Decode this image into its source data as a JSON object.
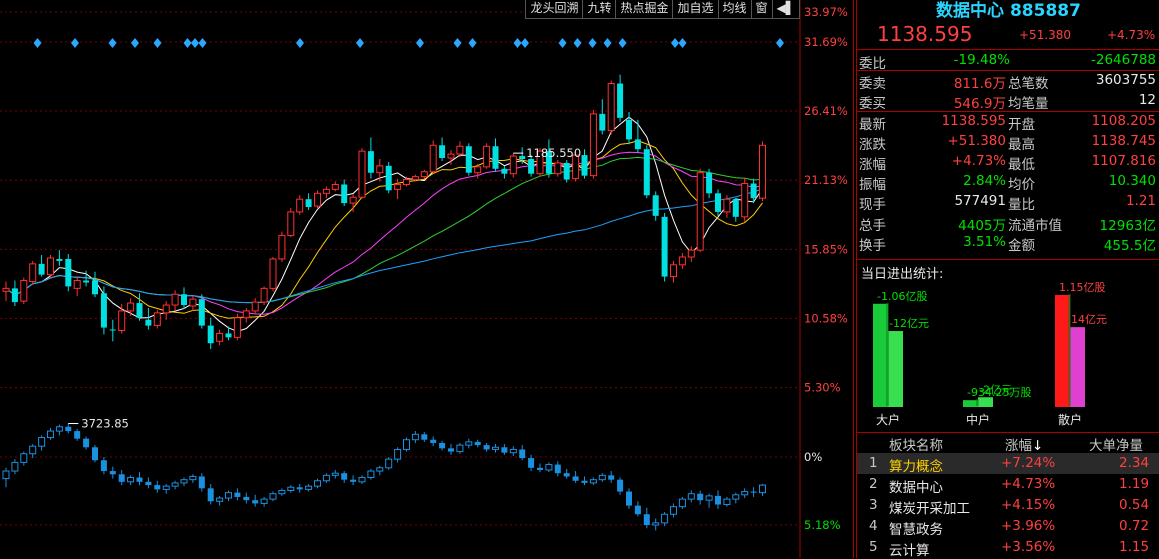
{
  "toolbar": {
    "items": [
      "龙头回溯",
      "九转",
      "热点掘金",
      "加自选",
      "均线",
      "窗"
    ]
  },
  "chart_data": {
    "type": "candlestick",
    "pct_axis": {
      "ticks": [
        {
          "label": "33.97%",
          "value": 33.97,
          "color": "#ff4040"
        },
        {
          "label": "31.69%",
          "value": 31.69,
          "color": "#ff4040"
        },
        {
          "label": "26.41%",
          "value": 26.41,
          "color": "#ff4040"
        },
        {
          "label": "21.13%",
          "value": 21.13,
          "color": "#ff4040"
        },
        {
          "label": "15.85%",
          "value": 15.85,
          "color": "#ff4040"
        },
        {
          "label": "10.58%",
          "value": 10.58,
          "color": "#ff4040"
        },
        {
          "label": "5.30%",
          "value": 5.3,
          "color": "#ff4040"
        },
        {
          "label": "0%",
          "value": 0,
          "color": "#e8e8e8"
        },
        {
          "label": "5.18%",
          "value": -5.18,
          "color": "#00e000"
        }
      ]
    },
    "annotations": [
      {
        "label": "1185.550",
        "series": "sector",
        "index": 57,
        "kind": "high"
      },
      {
        "label": "3723.85",
        "series": "index",
        "index": 7,
        "kind": "high"
      }
    ],
    "sector_series": {
      "name": "",
      "ohlc": [
        [
          21.5,
          22.5,
          20.5,
          21.8
        ],
        [
          21.8,
          22.6,
          20.0,
          20.4
        ],
        [
          20.5,
          22.9,
          20.2,
          22.6
        ],
        [
          22.5,
          24.6,
          22.2,
          24.3
        ],
        [
          24.3,
          25.2,
          23.0,
          23.2
        ],
        [
          23.2,
          25.2,
          22.8,
          24.9
        ],
        [
          24.8,
          25.7,
          24.1,
          24.6
        ],
        [
          24.8,
          25.3,
          21.5,
          22.0
        ],
        [
          21.8,
          23.0,
          21.0,
          22.6
        ],
        [
          22.6,
          23.6,
          22.0,
          22.4
        ],
        [
          22.6,
          23.5,
          20.9,
          21.2
        ],
        [
          21.3,
          22.0,
          17.1,
          17.8
        ],
        [
          17.6,
          18.6,
          16.4,
          17.5
        ],
        [
          17.5,
          20.2,
          17.2,
          19.5
        ],
        [
          19.5,
          20.8,
          19.0,
          20.3
        ],
        [
          20.3,
          21.3,
          18.5,
          18.8
        ],
        [
          18.6,
          19.8,
          17.6,
          18.0
        ],
        [
          18.0,
          19.6,
          17.7,
          19.3
        ],
        [
          19.3,
          20.5,
          18.6,
          20.1
        ],
        [
          20.1,
          21.6,
          19.5,
          21.2
        ],
        [
          21.2,
          21.9,
          19.7,
          20.1
        ],
        [
          20.0,
          21.0,
          19.5,
          20.7
        ],
        [
          20.7,
          21.2,
          17.7,
          18.0
        ],
        [
          18.0,
          18.8,
          15.6,
          16.2
        ],
        [
          16.4,
          17.6,
          16.0,
          17.2
        ],
        [
          17.2,
          17.9,
          16.5,
          16.8
        ],
        [
          16.8,
          19.2,
          16.5,
          18.8
        ],
        [
          18.8,
          19.8,
          18.3,
          19.5
        ],
        [
          19.5,
          20.8,
          19.2,
          20.4
        ],
        [
          20.4,
          22.0,
          20.1,
          21.8
        ],
        [
          21.8,
          25.0,
          21.5,
          24.8
        ],
        [
          24.8,
          27.6,
          24.5,
          27.2
        ],
        [
          27.2,
          30.0,
          27.0,
          29.6
        ],
        [
          29.6,
          31.3,
          29.3,
          30.9
        ],
        [
          30.9,
          31.5,
          29.8,
          30.1
        ],
        [
          30.2,
          31.8,
          30.0,
          31.5
        ],
        [
          31.5,
          32.2,
          31.0,
          31.9
        ],
        [
          31.9,
          32.7,
          31.7,
          32.4
        ],
        [
          32.4,
          32.9,
          30.2,
          30.5
        ],
        [
          30.5,
          31.4,
          29.6,
          31.1
        ],
        [
          31.1,
          36.1,
          31.0,
          35.8
        ],
        [
          35.8,
          37.2,
          33.0,
          33.6
        ],
        [
          33.6,
          35.0,
          32.7,
          34.3
        ],
        [
          34.3,
          34.7,
          31.5,
          31.8
        ],
        [
          31.9,
          33.0,
          30.9,
          32.4
        ],
        [
          32.4,
          33.2,
          32.2,
          32.9
        ],
        [
          32.9,
          33.4,
          32.7,
          33.2
        ],
        [
          33.2,
          33.9,
          33.0,
          33.7
        ],
        [
          33.7,
          36.9,
          33.5,
          36.4
        ],
        [
          36.4,
          37.2,
          34.8,
          35.1
        ],
        [
          35.1,
          35.9,
          34.4,
          35.5
        ],
        [
          35.5,
          36.8,
          35.2,
          36.3
        ],
        [
          36.3,
          36.6,
          33.3,
          33.6
        ],
        [
          33.6,
          34.5,
          33.0,
          34.2
        ],
        [
          34.2,
          36.6,
          34.0,
          36.3
        ],
        [
          36.3,
          37.1,
          33.7,
          34.0
        ],
        [
          34.0,
          34.3,
          33.0,
          33.5
        ],
        [
          33.5,
          35.6,
          33.1,
          35.3
        ],
        [
          35.3,
          36.2,
          34.5,
          35.0
        ],
        [
          35.0,
          35.4,
          33.2,
          33.5
        ],
        [
          33.5,
          36.1,
          33.2,
          35.8
        ],
        [
          35.8,
          37.0,
          33.1,
          33.5
        ],
        [
          33.5,
          34.9,
          33.2,
          34.6
        ],
        [
          34.6,
          34.9,
          32.6,
          32.9
        ],
        [
          33.0,
          35.7,
          32.7,
          35.4
        ],
        [
          35.4,
          36.0,
          33.0,
          33.3
        ],
        [
          33.3,
          40.0,
          33.0,
          39.6
        ],
        [
          39.6,
          41.1,
          37.5,
          37.9
        ],
        [
          37.9,
          43.0,
          37.5,
          42.7
        ],
        [
          42.7,
          43.6,
          38.8,
          39.2
        ],
        [
          39.0,
          39.8,
          36.5,
          37.0
        ],
        [
          37.0,
          39.0,
          35.6,
          36.0
        ],
        [
          36.0,
          36.4,
          31.0,
          31.3
        ],
        [
          31.3,
          31.7,
          28.7,
          29.2
        ],
        [
          29.1,
          29.5,
          22.5,
          23.0
        ],
        [
          23.0,
          24.6,
          22.4,
          24.2
        ],
        [
          24.2,
          25.4,
          23.8,
          25.0
        ],
        [
          25.0,
          26.1,
          24.5,
          25.7
        ],
        [
          25.7,
          34.0,
          25.5,
          33.6
        ],
        [
          33.6,
          34.0,
          31.0,
          31.5
        ],
        [
          31.5,
          31.9,
          29.2,
          29.6
        ],
        [
          29.6,
          31.3,
          29.0,
          30.9
        ],
        [
          30.9,
          31.0,
          28.6,
          29.1
        ],
        [
          29.1,
          33.1,
          28.6,
          32.5
        ],
        [
          32.5,
          33.0,
          30.5,
          31.0
        ],
        [
          31.0,
          36.8,
          30.7,
          36.4
        ]
      ]
    },
    "index_series": {
      "name": "",
      "ohlc": [
        [
          -2.0,
          -1.0,
          -2.8,
          -1.3
        ],
        [
          -1.3,
          -0.2,
          -1.6,
          -0.5
        ],
        [
          -0.5,
          0.5,
          -0.8,
          0.3
        ],
        [
          0.3,
          1.2,
          -0.1,
          1.0
        ],
        [
          1.0,
          2.0,
          0.6,
          1.8
        ],
        [
          1.8,
          2.7,
          1.6,
          2.4
        ],
        [
          2.4,
          3.0,
          2.0,
          2.8
        ],
        [
          2.8,
          3.1,
          2.2,
          2.4
        ],
        [
          2.4,
          2.6,
          1.5,
          1.7
        ],
        [
          1.7,
          1.9,
          0.7,
          0.9
        ],
        [
          0.9,
          1.1,
          -0.5,
          -0.3
        ],
        [
          -0.3,
          0.0,
          -1.6,
          -1.3
        ],
        [
          -1.3,
          -0.9,
          -2.0,
          -1.6
        ],
        [
          -1.6,
          -1.2,
          -2.6,
          -2.3
        ],
        [
          -2.3,
          -1.7,
          -2.6,
          -1.9
        ],
        [
          -1.9,
          -1.4,
          -2.6,
          -2.3
        ],
        [
          -2.3,
          -1.9,
          -2.9,
          -2.6
        ],
        [
          -2.6,
          -2.2,
          -3.3,
          -3.0
        ],
        [
          -3.0,
          -2.5,
          -3.4,
          -2.7
        ],
        [
          -2.7,
          -2.2,
          -3.0,
          -2.4
        ],
        [
          -2.4,
          -1.9,
          -2.7,
          -2.1
        ],
        [
          -2.1,
          -1.6,
          -2.4,
          -1.8
        ],
        [
          -1.8,
          -1.5,
          -3.2,
          -2.9
        ],
        [
          -2.9,
          -2.5,
          -4.4,
          -4.1
        ],
        [
          -4.1,
          -3.6,
          -4.5,
          -3.8
        ],
        [
          -3.8,
          -3.1,
          -4.1,
          -3.3
        ],
        [
          -3.3,
          -2.9,
          -4.0,
          -3.7
        ],
        [
          -3.7,
          -3.3,
          -4.3,
          -4.0
        ],
        [
          -4.0,
          -3.5,
          -4.6,
          -4.3
        ],
        [
          -4.3,
          -3.7,
          -4.6,
          -3.9
        ],
        [
          -3.9,
          -3.2,
          -4.1,
          -3.4
        ],
        [
          -3.4,
          -2.9,
          -3.6,
          -3.1
        ],
        [
          -3.1,
          -2.6,
          -3.3,
          -2.8
        ],
        [
          -2.8,
          -2.5,
          -3.3,
          -3.0
        ],
        [
          -3.0,
          -2.5,
          -3.2,
          -2.7
        ],
        [
          -2.7,
          -2.0,
          -2.9,
          -2.2
        ],
        [
          -2.2,
          -1.5,
          -2.4,
          -1.7
        ],
        [
          -1.7,
          -1.2,
          -2.0,
          -1.5
        ],
        [
          -1.5,
          -1.3,
          -2.4,
          -2.1
        ],
        [
          -2.1,
          -1.7,
          -2.6,
          -2.3
        ],
        [
          -2.3,
          -1.7,
          -2.5,
          -1.9
        ],
        [
          -1.9,
          -1.1,
          -2.1,
          -1.3
        ],
        [
          -1.3,
          -0.8,
          -1.7,
          -1.0
        ],
        [
          -1.0,
          0.0,
          -1.2,
          -0.2
        ],
        [
          -0.2,
          0.9,
          -0.5,
          0.7
        ],
        [
          0.7,
          1.8,
          0.5,
          1.6
        ],
        [
          1.6,
          2.4,
          1.3,
          2.1
        ],
        [
          2.1,
          2.3,
          1.4,
          1.6
        ],
        [
          1.6,
          1.9,
          1.0,
          1.3
        ],
        [
          1.3,
          1.5,
          0.6,
          0.8
        ],
        [
          0.8,
          1.2,
          0.2,
          0.5
        ],
        [
          0.5,
          1.3,
          0.3,
          1.1
        ],
        [
          1.1,
          1.7,
          0.8,
          1.4
        ],
        [
          1.4,
          1.6,
          0.9,
          1.1
        ],
        [
          1.1,
          1.3,
          0.5,
          0.7
        ],
        [
          0.7,
          1.2,
          0.4,
          0.9
        ],
        [
          0.9,
          1.2,
          0.2,
          0.4
        ],
        [
          0.4,
          1.0,
          0.1,
          0.7
        ],
        [
          0.7,
          1.1,
          -0.3,
          -0.1
        ],
        [
          -0.1,
          0.2,
          -1.3,
          -1.0
        ],
        [
          -1.0,
          -0.6,
          -1.4,
          -1.2
        ],
        [
          -1.2,
          -0.5,
          -1.4,
          -0.7
        ],
        [
          -0.7,
          -0.4,
          -1.8,
          -1.5
        ],
        [
          -1.5,
          -1.1,
          -2.0,
          -1.8
        ],
        [
          -1.8,
          -1.3,
          -2.4,
          -2.2
        ],
        [
          -2.2,
          -1.8,
          -2.6,
          -2.4
        ],
        [
          -2.4,
          -1.9,
          -2.6,
          -2.1
        ],
        [
          -2.1,
          -1.5,
          -2.3,
          -1.7
        ],
        [
          -1.7,
          -1.3,
          -2.4,
          -2.1
        ],
        [
          -2.1,
          -1.9,
          -3.5,
          -3.2
        ],
        [
          -3.2,
          -2.9,
          -4.8,
          -4.5
        ],
        [
          -4.5,
          -4.1,
          -5.5,
          -5.3
        ],
        [
          -5.3,
          -4.7,
          -6.6,
          -6.3
        ],
        [
          -6.3,
          -5.7,
          -6.8,
          -6.1
        ],
        [
          -6.1,
          -5.1,
          -6.4,
          -5.3
        ],
        [
          -5.3,
          -4.3,
          -5.6,
          -4.6
        ],
        [
          -4.6,
          -3.7,
          -4.8,
          -3.9
        ],
        [
          -3.9,
          -3.1,
          -4.2,
          -3.4
        ],
        [
          -3.4,
          -3.1,
          -4.4,
          -4.0
        ],
        [
          -4.0,
          -3.4,
          -4.7,
          -3.6
        ],
        [
          -3.6,
          -3.1,
          -4.8,
          -4.4
        ],
        [
          -4.4,
          -3.7,
          -4.6,
          -3.9
        ],
        [
          -3.9,
          -3.3,
          -4.3,
          -3.5
        ],
        [
          -3.5,
          -2.9,
          -3.8,
          -3.2
        ],
        [
          -3.2,
          -2.8,
          -3.7,
          -3.3
        ],
        [
          -3.3,
          -2.5,
          -3.6,
          -2.6
        ]
      ]
    },
    "signal_markers": [
      1,
      6,
      11,
      14,
      17,
      21,
      22,
      23,
      36,
      44,
      52,
      57,
      59,
      65,
      66,
      71,
      73,
      75,
      77,
      79,
      86,
      87,
      100
    ]
  },
  "quote": {
    "title": "数据中心 885887",
    "price": "1138.595",
    "change": "+51.380",
    "change_pct": "+4.73%",
    "rows_top": [
      {
        "label": "委比",
        "value": "-19.48%",
        "value_color": "green",
        "extra": "-2646788",
        "extra_color": "green"
      }
    ],
    "rows_mid": [
      {
        "l1": "委卖",
        "v1": "811.6万",
        "c1": "red",
        "l2": "总笔数",
        "v2": "3603755",
        "c2": "white"
      },
      {
        "l1": "委买",
        "v1": "546.9万",
        "c1": "red",
        "l2": "均笔量",
        "v2": "12",
        "c2": "white"
      }
    ],
    "rows_bottom": [
      {
        "l1": "最新",
        "v1": "1138.595",
        "c1": "red",
        "l2": "开盘",
        "v2": "1108.205",
        "c2": "red"
      },
      {
        "l1": "涨跌",
        "v1": "+51.380",
        "c1": "red",
        "l2": "最高",
        "v2": "1138.745",
        "c2": "red"
      },
      {
        "l1": "涨幅",
        "v1": "+4.73%",
        "c1": "red",
        "l2": "最低",
        "v2": "1107.816",
        "c2": "red"
      },
      {
        "l1": "振幅",
        "v1": "2.84%",
        "c1": "green",
        "l2": "均价",
        "v2": "10.340",
        "c2": "green"
      },
      {
        "l1": "现手",
        "v1": "577491",
        "c1": "white",
        "l2": "量比",
        "v2": "1.21",
        "c2": "red"
      },
      {
        "l1": "总手",
        "v1": "4405万",
        "c1": "green",
        "l2": "流通市值",
        "v2": "12963亿",
        "c2": "green"
      },
      {
        "l1": "换手",
        "v1": "3.51%",
        "c1": "green",
        "l2": "金额",
        "v2": "455.5亿",
        "c2": "green"
      }
    ]
  },
  "flow": {
    "title": "当日进出统计:",
    "groups": [
      {
        "name": "大户",
        "in_label": "-1.06亿股",
        "in_value": 1.06,
        "out_label": "-12亿元",
        "out_value": 0.78,
        "color_in": "#1bcc3a",
        "color_out": "#38e050",
        "label_color": "#00e000"
      },
      {
        "name": "中户",
        "in_label": "-934.25万股",
        "in_value": 0.07,
        "out_label": "-2亿元",
        "out_value": 0.1,
        "color_in": "#1bcc3a",
        "color_out": "#38e050",
        "label_color": "#00e000"
      },
      {
        "name": "散户",
        "in_label": "1.15亿股",
        "in_value": 1.15,
        "out_label": "14亿元",
        "out_value": 0.82,
        "color_in": "#ff1a1a",
        "color_out": "#e040d0",
        "label_color": "#ff4040"
      }
    ]
  },
  "sectors": {
    "headers": [
      "板块名称",
      "涨幅",
      "大单净量"
    ],
    "rows": [
      {
        "rank": "1",
        "name": "算力概念",
        "pct": "+7.24%",
        "net": "2.34"
      },
      {
        "rank": "2",
        "name": "数据中心",
        "pct": "+4.73%",
        "net": "1.19"
      },
      {
        "rank": "3",
        "name": "煤炭开采加工",
        "pct": "+4.15%",
        "net": "0.54"
      },
      {
        "rank": "4",
        "name": "智慧政务",
        "pct": "+3.96%",
        "net": "0.72"
      },
      {
        "rank": "5",
        "name": "云计算",
        "pct": "+3.56%",
        "net": "1.15"
      }
    ]
  }
}
